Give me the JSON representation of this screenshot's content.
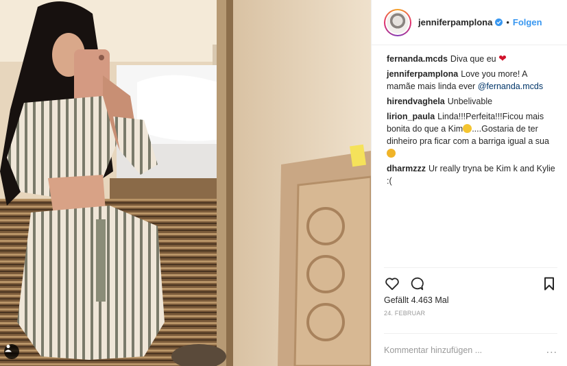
{
  "header": {
    "username": "jenniferpamplona",
    "separator": "•",
    "follow_label": "Folgen"
  },
  "comments": [
    {
      "author": "fernanda.mcds",
      "text": "Diva que eu",
      "emoji": "heart"
    },
    {
      "author": "jenniferpamplona",
      "text": "Love you more! A mamãe mais linda ever",
      "mention": "@fernanda.mcds"
    },
    {
      "author": "hirendvaghela",
      "text": "Unbelivable"
    },
    {
      "author": "lirion_paula",
      "text_before": "Linda!!!Perfeita!!!Ficou mais bonita do que a Kim",
      "text_after": "....Gostaria de ter dinheiro pra ficar com a barriga igual a sua"
    },
    {
      "author": "dharmzzz",
      "text": "Ur really tryna be Kim k and Kylie :("
    }
  ],
  "actions": {
    "likes_label": "Gefällt 4.463 Mal",
    "date": "24. FEBRUAR"
  },
  "comment_input": {
    "placeholder": "Kommentar hinzufügen ...",
    "more_label": "..."
  },
  "icons": {
    "like": "heart-outline-icon",
    "comment": "speech-bubble-icon",
    "save": "bookmark-icon",
    "user_tag": "person-icon",
    "verified": "verified-badge-icon"
  },
  "colors": {
    "link": "#3897f0",
    "mention": "#003569",
    "muted": "#999999",
    "heart": "#d0142c"
  }
}
